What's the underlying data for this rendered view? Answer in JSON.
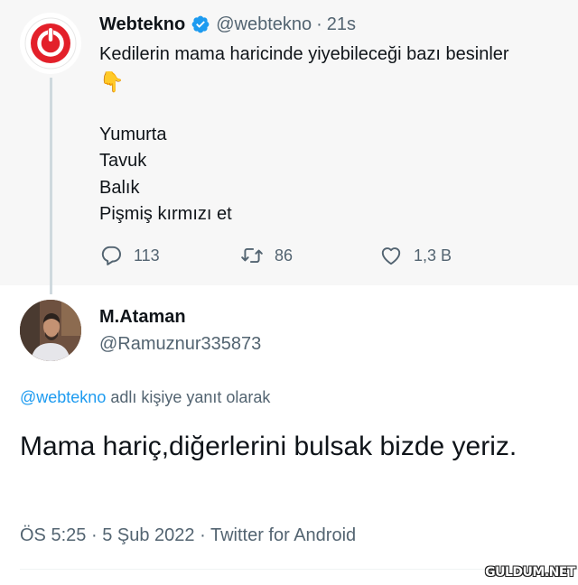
{
  "parent_tweet": {
    "author_name": "Webtekno",
    "author_handle": "@webtekno",
    "separator": "·",
    "time": "21s",
    "text_lines": [
      "Kedilerin mama haricinde yiyebileceği bazı besinler",
      "👇",
      "",
      "Yumurta",
      "Tavuk",
      "Balık",
      "Pişmiş kırmızı et"
    ],
    "reply_count": "113",
    "retweet_count": "86",
    "like_count": "1,3 B",
    "icons": [
      "webtekno-logo-icon",
      "verified-badge-icon",
      "reply-icon",
      "retweet-icon",
      "like-icon"
    ],
    "colors": {
      "logo_red": "#e3202a",
      "verified_blue": "#1d9bf0",
      "background": "#f7f7f7"
    }
  },
  "reply_tweet": {
    "author_name": "M.Ataman",
    "author_handle": "@Ramuznur335873",
    "replying_mention": "@webtekno",
    "replying_suffix": " adlı kişiye yanıt olarak",
    "text": "Mama hariç,diğerlerini bulsak bizde yeriz.",
    "time": "ÖS 5:25",
    "date": "5 Şub 2022",
    "source": "Twitter for Android",
    "separator": "·"
  },
  "watermark": "GULDUM.NET"
}
